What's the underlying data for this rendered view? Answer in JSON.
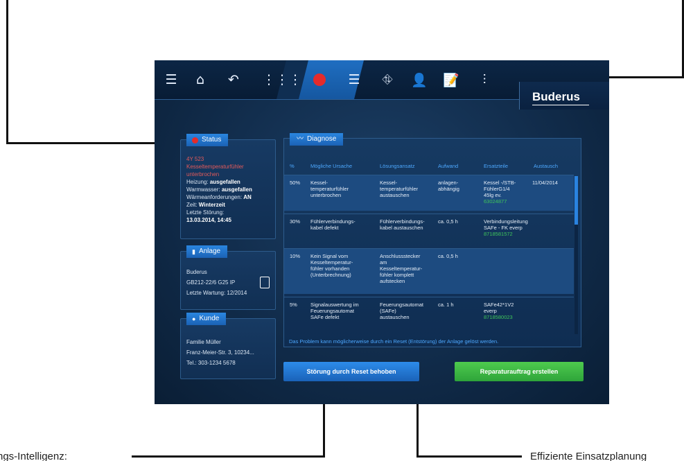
{
  "brand": "Buderus",
  "toolbar": {
    "icons": [
      "menu-icon",
      "home-icon",
      "back-icon",
      "grid-icon",
      "alarm-icon",
      "list-icon",
      "hierarchy-icon",
      "user-icon",
      "checklist-icon",
      "sliders-icon"
    ]
  },
  "status_card": {
    "title": "Status",
    "error_code": "4Y 523",
    "error_text": "Kesseltemperaturfühler unterbrochen",
    "lines": [
      {
        "label": "Heizung: ",
        "value": "ausgefallen"
      },
      {
        "label": "Warmwasser: ",
        "value": "ausgefallen"
      },
      {
        "label": "Wärmeanforderungen: ",
        "value": "AN"
      },
      {
        "label": "Zeit: ",
        "value": "Winterzeit"
      }
    ],
    "last_fault_label": "Letzte Störung:",
    "last_fault_value": "13.03.2014, 14:45"
  },
  "anlage_card": {
    "title": "Anlage",
    "manufacturer": "Buderus",
    "model": "GB212-22/6 G25 IP",
    "service": "Letzte Wartung: 12/2014"
  },
  "kunde_card": {
    "title": "Kunde",
    "name": "Familie Müller",
    "address": "Franz-Meier-Str. 3, 10234...",
    "phone": "Tel.: 303-1234 5678"
  },
  "diagnose": {
    "title": "Diagnose",
    "headers": [
      "%",
      "Mögliche Ursache",
      "Lösungsansatz",
      "Aufwand",
      "Ersatzteile",
      "Austausch"
    ],
    "rows": [
      {
        "pct": "50%",
        "cause": "Kessel-\ntemperaturfühler\nunterbrochen",
        "solution": "Kessel-\ntemperaturfühler\naustauschen",
        "effort": "anlagen-\nabhängig",
        "part": "Kessel -/STB-\nFühlerG1/4\n45lg ev.",
        "part_no": "63024877",
        "date": "11/04/2014"
      },
      {
        "pct": "30%",
        "cause": "Fühlerverbindungs-\nkabel defekt",
        "solution": "Fühlerverbindungs-\nkabel austauschen",
        "effort": "ca. 0,5 h",
        "part": "Verbindungsleitung\nSAFe - FK everp",
        "part_no": "8718581572",
        "date": ""
      },
      {
        "pct": "10%",
        "cause": "Kein Signal vom\nKesseltemperatur-\nfühler vorhanden\n(Unterbrechnung)",
        "solution": "Anschlussstecker\nam\nKesseltemperatur-\nfühler komplett\naufstecken",
        "effort": "ca. 0,5 h",
        "part": "",
        "part_no": "",
        "date": ""
      },
      {
        "pct": "5%",
        "cause": "Signalauswertung im\nFeuerungsautomat\nSAFe defekt",
        "solution": "Feuerungsautomat\n(SAFe)\naustauschen",
        "effort": "ca. 1 h",
        "part": "SAFe42*1V2\neverp",
        "part_no": "8718580023",
        "date": ""
      }
    ],
    "note": "Das Problem kann möglicherweise durch ein Reset (Entstörung) der Anlage gelöst werden."
  },
  "buttons": {
    "reset": "Störung durch Reset behoben",
    "repair": "Reparaturauftrag erstellen"
  },
  "callouts": {
    "left": "ngs-Intelligenz:",
    "right": "Effiziente Einsatzplanung"
  }
}
